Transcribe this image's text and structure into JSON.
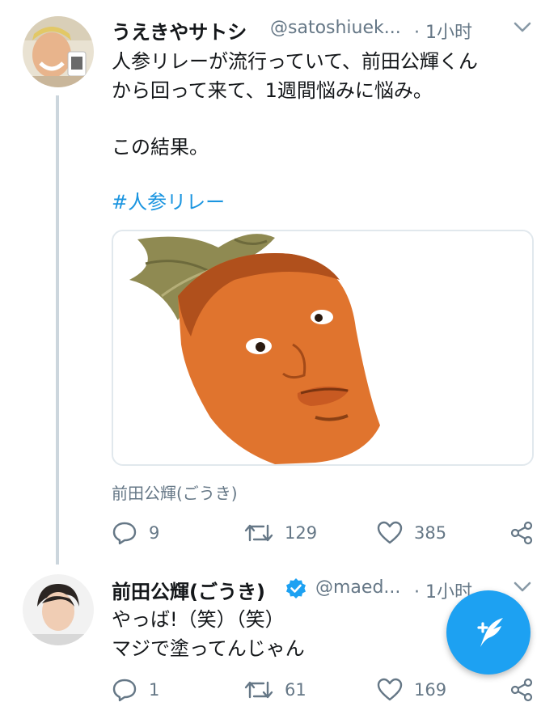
{
  "tweet1": {
    "author_name": "うえきやサトシ",
    "handle": "@satoshiuek...",
    "time": "· 1小时",
    "text_lines": [
      "人参リレーが流行っていて、前田公輝くん",
      "から回って来て、1週間悩みに悩み。",
      "",
      "この結果。"
    ],
    "hashtag": "#人参リレー",
    "media_caption": "前田公輝(ごうき)",
    "reply_count": "9",
    "retweet_count": "129",
    "like_count": "385"
  },
  "tweet2": {
    "author_name": "前田公輝(ごうき)",
    "handle": "@maed...",
    "time": "· 1小时",
    "text_lines": [
      "やっば!（笑）（笑）",
      "マジで塗ってんじゃん"
    ],
    "reply_count": "1",
    "retweet_count": "61",
    "like_count": "169"
  },
  "icons": {
    "reply": "reply-icon",
    "retweet": "retweet-icon",
    "like": "heart-icon",
    "share": "share-icon",
    "more": "chevron-down-icon",
    "verified": "verified-badge-icon",
    "compose": "compose-feather-icon"
  },
  "colors": {
    "accent": "#1da1f2",
    "link": "#1b95e0",
    "secondary_text": "#657786",
    "thread_line": "#ccd6dd"
  }
}
